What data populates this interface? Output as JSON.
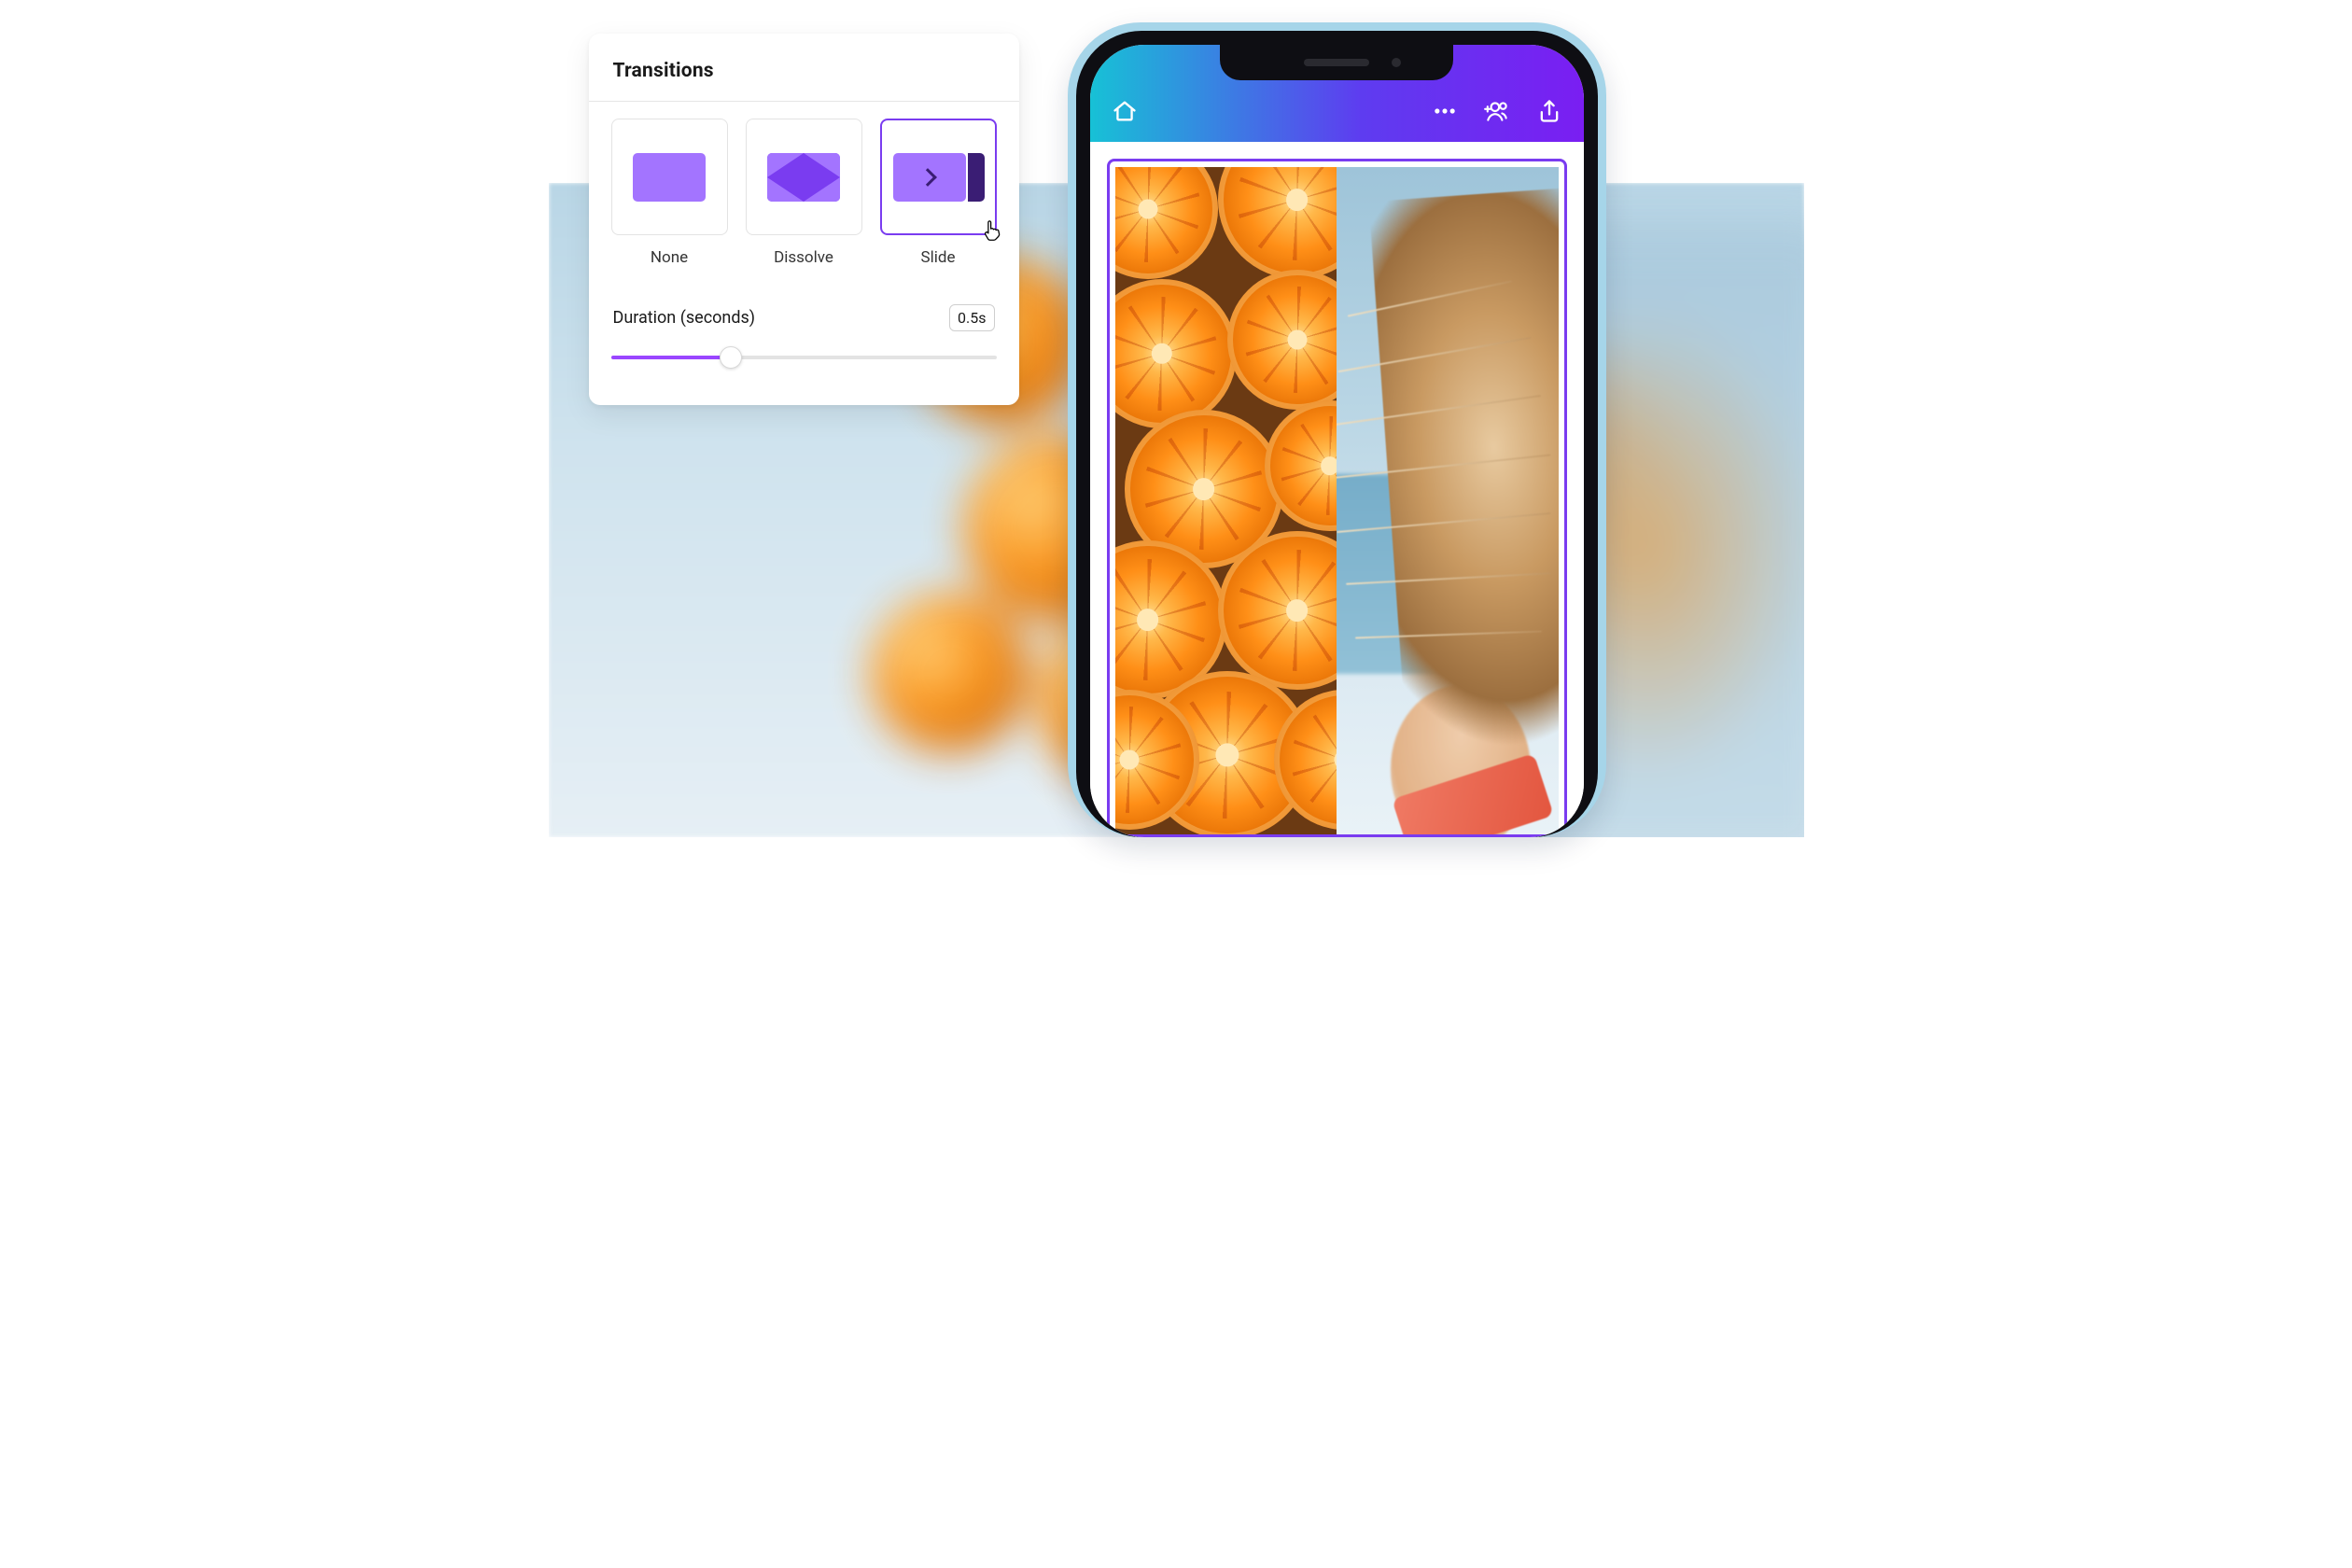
{
  "panel": {
    "title": "Transitions",
    "options": [
      {
        "id": "none",
        "label": "None",
        "selected": false
      },
      {
        "id": "dissolve",
        "label": "Dissolve",
        "selected": false
      },
      {
        "id": "slide",
        "label": "Slide",
        "selected": true
      }
    ],
    "duration": {
      "label": "Duration (seconds)",
      "display_value": "0.5s",
      "min": 0,
      "max": 1.5,
      "value": 0.5,
      "percent": 31
    }
  },
  "phone": {
    "header": {
      "icons": {
        "home": "home-icon",
        "more": "more-icon",
        "invite": "add-people-icon",
        "share": "share-icon"
      }
    }
  },
  "colors": {
    "accent": "#7a3cf0",
    "accent_light": "#a374ff",
    "gradient_start": "#17c1d6",
    "gradient_end": "#7a1ef2"
  }
}
